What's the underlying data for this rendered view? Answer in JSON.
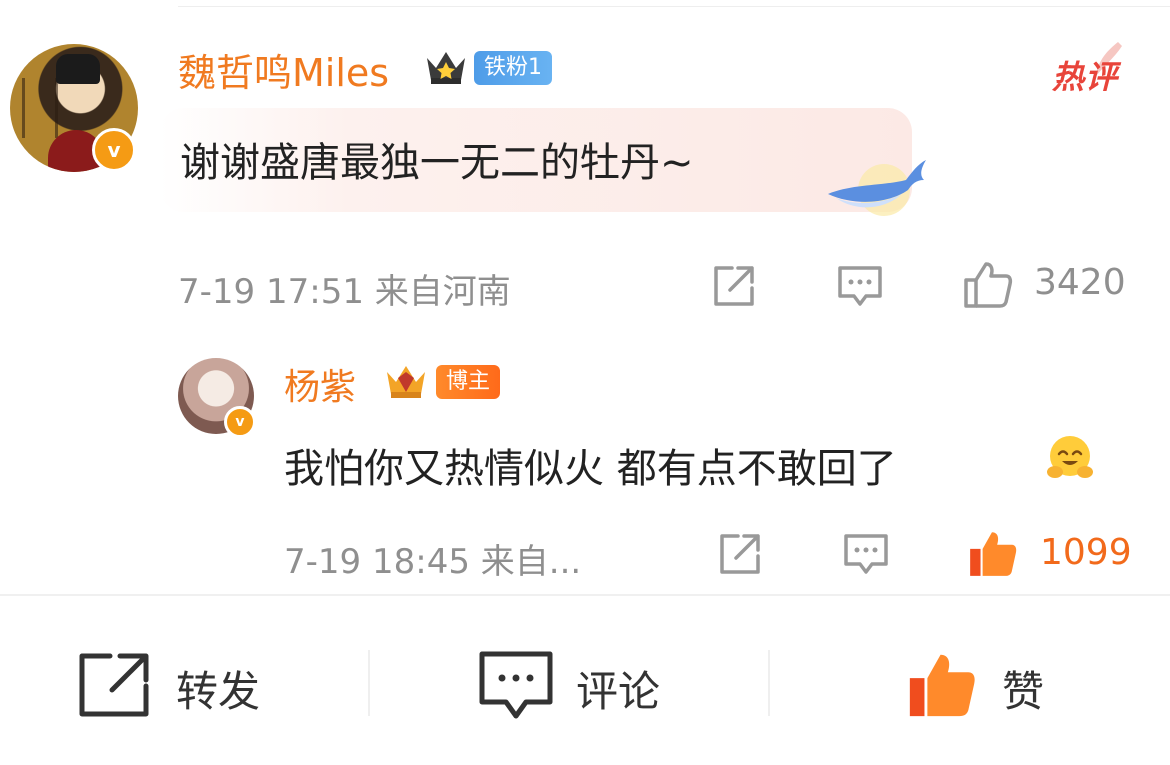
{
  "comment": {
    "author": "魏哲鸣Miles",
    "fan_badge": "铁粉1",
    "hot_label": "热评",
    "text": "谢谢盛唐最独一无二的牡丹~",
    "meta": "7-19 17:51 来自河南",
    "like_count": "3420",
    "verified_icon": "v"
  },
  "reply": {
    "author": "杨紫",
    "badge": "博主",
    "text": "我怕你又热情似火 都有点不敢回了",
    "meta": "7-19 18:45 来自...",
    "like_count": "1099",
    "liked": true,
    "verified_icon": "v"
  },
  "bottom_bar": {
    "repost_label": "转发",
    "comment_label": "评论",
    "like_label": "赞"
  },
  "colors": {
    "name": "#f07a20",
    "hot": "#e8443a",
    "liked": "#f26a1b",
    "meta": "#8f8f8f"
  }
}
